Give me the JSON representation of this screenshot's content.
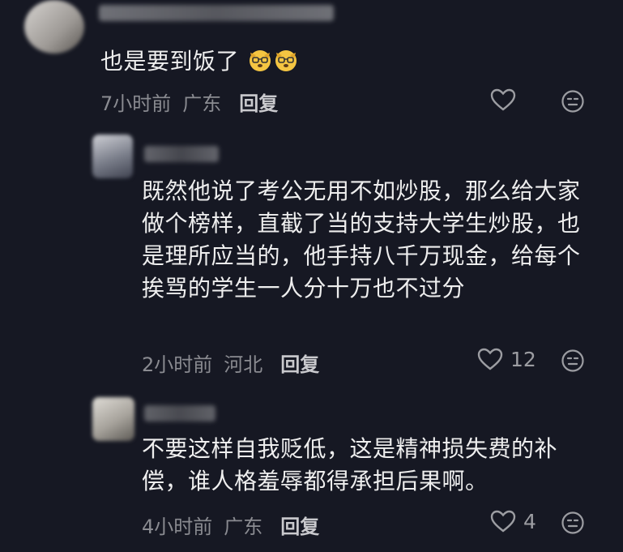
{
  "comments": [
    {
      "text": "也是要到饭了",
      "time": "7小时前",
      "location": "广东",
      "reply_label": "回复",
      "likes": "",
      "emojis": [
        "dog-face-emoji",
        "dog-face-emoji"
      ]
    },
    {
      "text": "既然他说了考公无用不如炒股，那么给大家做个榜样，直截了当的支持大学生炒股，也是理所应当的，他手持八千万现金，给每个挨骂的学生一人分十万也不过分",
      "time": "2小时前",
      "location": "河北",
      "reply_label": "回复",
      "likes": "12"
    },
    {
      "text": "不要这样自我贬低，这是精神损失费的补偿，谁人格羞辱都得承担后果啊。",
      "time": "4小时前",
      "location": "广东",
      "reply_label": "回复",
      "likes": "4"
    }
  ],
  "colors": {
    "background": "#161823",
    "text": "#eeeeee",
    "meta": "#8a8b91",
    "emoji_yellow": "#f4c542"
  }
}
